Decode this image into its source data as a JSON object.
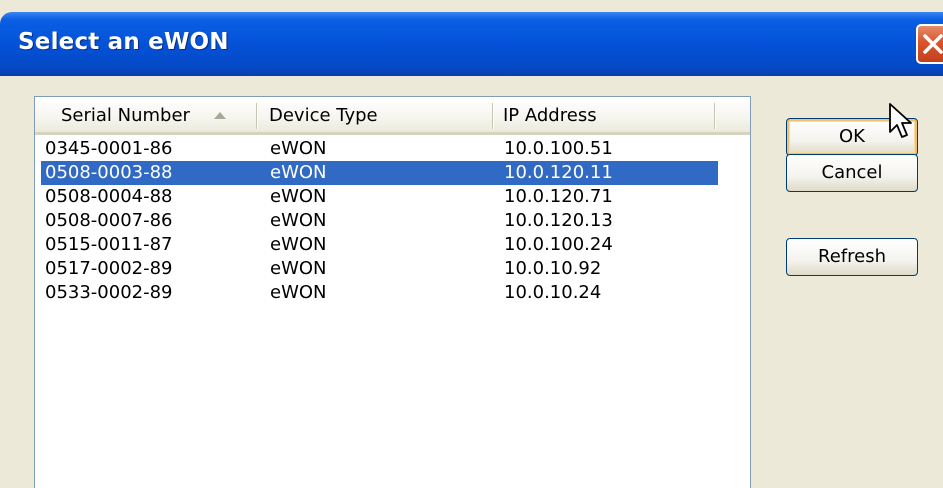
{
  "window": {
    "title": "Select an eWON"
  },
  "list": {
    "columns": [
      "Serial Number",
      "Device Type",
      "IP Address"
    ],
    "sorted_column": "Serial Number",
    "sort_direction": "ascending",
    "selected_index": 1,
    "rows": [
      {
        "serial": "0345-0001-86",
        "type": "eWON",
        "ip": "10.0.100.51"
      },
      {
        "serial": "0508-0003-88",
        "type": "eWON",
        "ip": "10.0.120.11"
      },
      {
        "serial": "0508-0004-88",
        "type": "eWON",
        "ip": "10.0.120.71"
      },
      {
        "serial": "0508-0007-86",
        "type": "eWON",
        "ip": "10.0.120.13"
      },
      {
        "serial": "0515-0011-87",
        "type": "eWON",
        "ip": "10.0.100.24"
      },
      {
        "serial": "0517-0002-89",
        "type": "eWON",
        "ip": "10.0.10.92"
      },
      {
        "serial": "0533-0002-89",
        "type": "eWON",
        "ip": "10.0.10.24"
      }
    ]
  },
  "buttons": {
    "ok": "OK",
    "cancel": "Cancel",
    "refresh": "Refresh"
  },
  "colors": {
    "titlebar": "#0452d8",
    "selection": "#316ac5",
    "close": "#d9542c",
    "dialog_bg": "#ece9d8"
  },
  "icons": {
    "close": "close-icon",
    "sort": "sort-ascending-icon",
    "cursor": "mouse-pointer-icon"
  }
}
